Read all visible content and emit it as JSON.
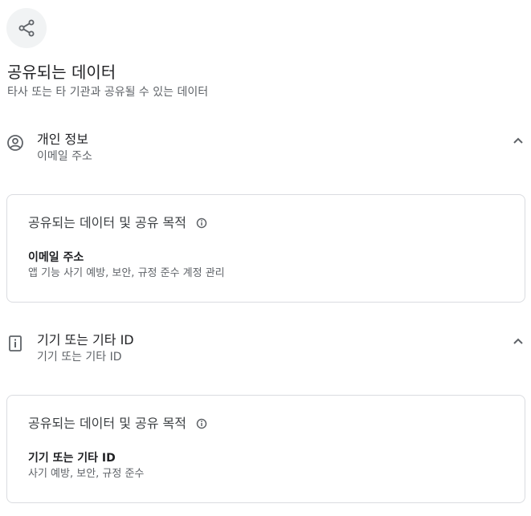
{
  "header": {
    "icon": "share-icon",
    "title": "공유되는 데이터",
    "subtitle": "타사 또는 타 기관과 공유될 수 있는 데이터"
  },
  "groups": [
    {
      "icon": "account-circle-icon",
      "title": "개인 정보",
      "summary": "이메일 주소",
      "expanded": true,
      "card": {
        "heading": "공유되는 데이터 및 공유 목적",
        "item_title": "이메일 주소",
        "item_purpose": "앱 기능 사기 예방, 보안, 규정 준수 계정 관리"
      }
    },
    {
      "icon": "device-info-icon",
      "title": "기기 또는 기타 ID",
      "summary": "기기 또는 기타 ID",
      "expanded": true,
      "card": {
        "heading": "공유되는 데이터 및 공유 목적",
        "item_title": "기기 또는 기타 ID",
        "item_purpose": "사기 예방, 보안, 규정 준수"
      }
    }
  ],
  "colors": {
    "icon_bg": "#f1f3f4",
    "border": "#dadce0",
    "text_primary": "#202124",
    "text_secondary": "#5f6368"
  }
}
